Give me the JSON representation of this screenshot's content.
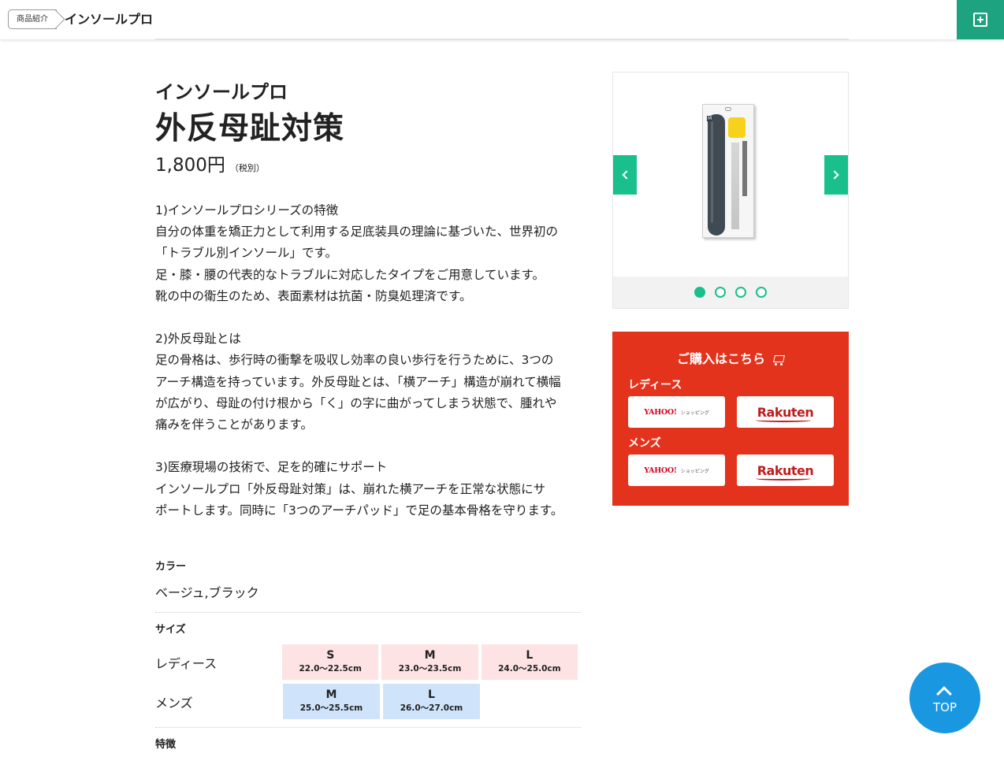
{
  "header": {
    "breadcrumb": "商品紹介",
    "title": "インソールプロ",
    "menu_icon": "plus-square-icon",
    "accent_color": "#1ea381"
  },
  "product": {
    "series": "インソールプロ",
    "name": "外反母趾対策",
    "price": "1,800円",
    "tax_note": "（税別）",
    "description": "1)インソールプロシリーズの特徴\n自分の体重を矯正力として利用する足底装具の理論に基づいた、世界初の\n「トラブル別インソール」です。\n足・膝・腰の代表的なトラブルに対応したタイプをご用意しています。\n靴の中の衛生のため、表面素材は抗菌・防臭処理済です。\n\n2)外反母趾とは\n足の骨格は、歩行時の衝撃を吸収し効率の良い歩行を行うために、3つの\nアーチ構造を持っています。外反母趾とは、「横アーチ」構造が崩れて横幅\nが広がり、母趾の付け根から「く」の字に曲がってしまう状態で、腫れや\n痛みを伴うことがあります。\n\n3)医療現場の技術で、足を的確にサポート\nインソールプロ「外反母趾対策」は、崩れた横アーチを正常な状態にサ\nポートします。同時に「3つのアーチパッド」で足の基本骨格を守ります。"
  },
  "spec": {
    "color_label": "カラー",
    "color_value": "ベージュ,ブラック",
    "size_label": "サイズ",
    "ladies_label": "レディース",
    "mens_label": "メンズ",
    "ladies_sizes": [
      {
        "size": "S",
        "range": "22.0〜22.5cm"
      },
      {
        "size": "M",
        "range": "23.0〜23.5cm"
      },
      {
        "size": "L",
        "range": "24.0〜25.0cm"
      }
    ],
    "mens_sizes": [
      {
        "size": "M",
        "range": "25.0〜25.5cm"
      },
      {
        "size": "L",
        "range": "26.0〜27.0cm"
      }
    ],
    "features_label": "特徴",
    "ladies_color": "#fde3e4",
    "mens_color": "#cfe4fb"
  },
  "carousel": {
    "slide_count": 4,
    "active_index": 0,
    "accent_color": "#1ac08b",
    "package_mark": "M"
  },
  "purchase": {
    "title": "ご購入はこちら",
    "ladies_label": "レディース",
    "mens_label": "メンズ",
    "yahoo_label": "YAHOO!",
    "yahoo_sub": "ショッピング",
    "rakuten_label": "Rakuten",
    "background": "#e4331c"
  },
  "top_button": {
    "label": "TOP",
    "color": "#1a97e1"
  }
}
